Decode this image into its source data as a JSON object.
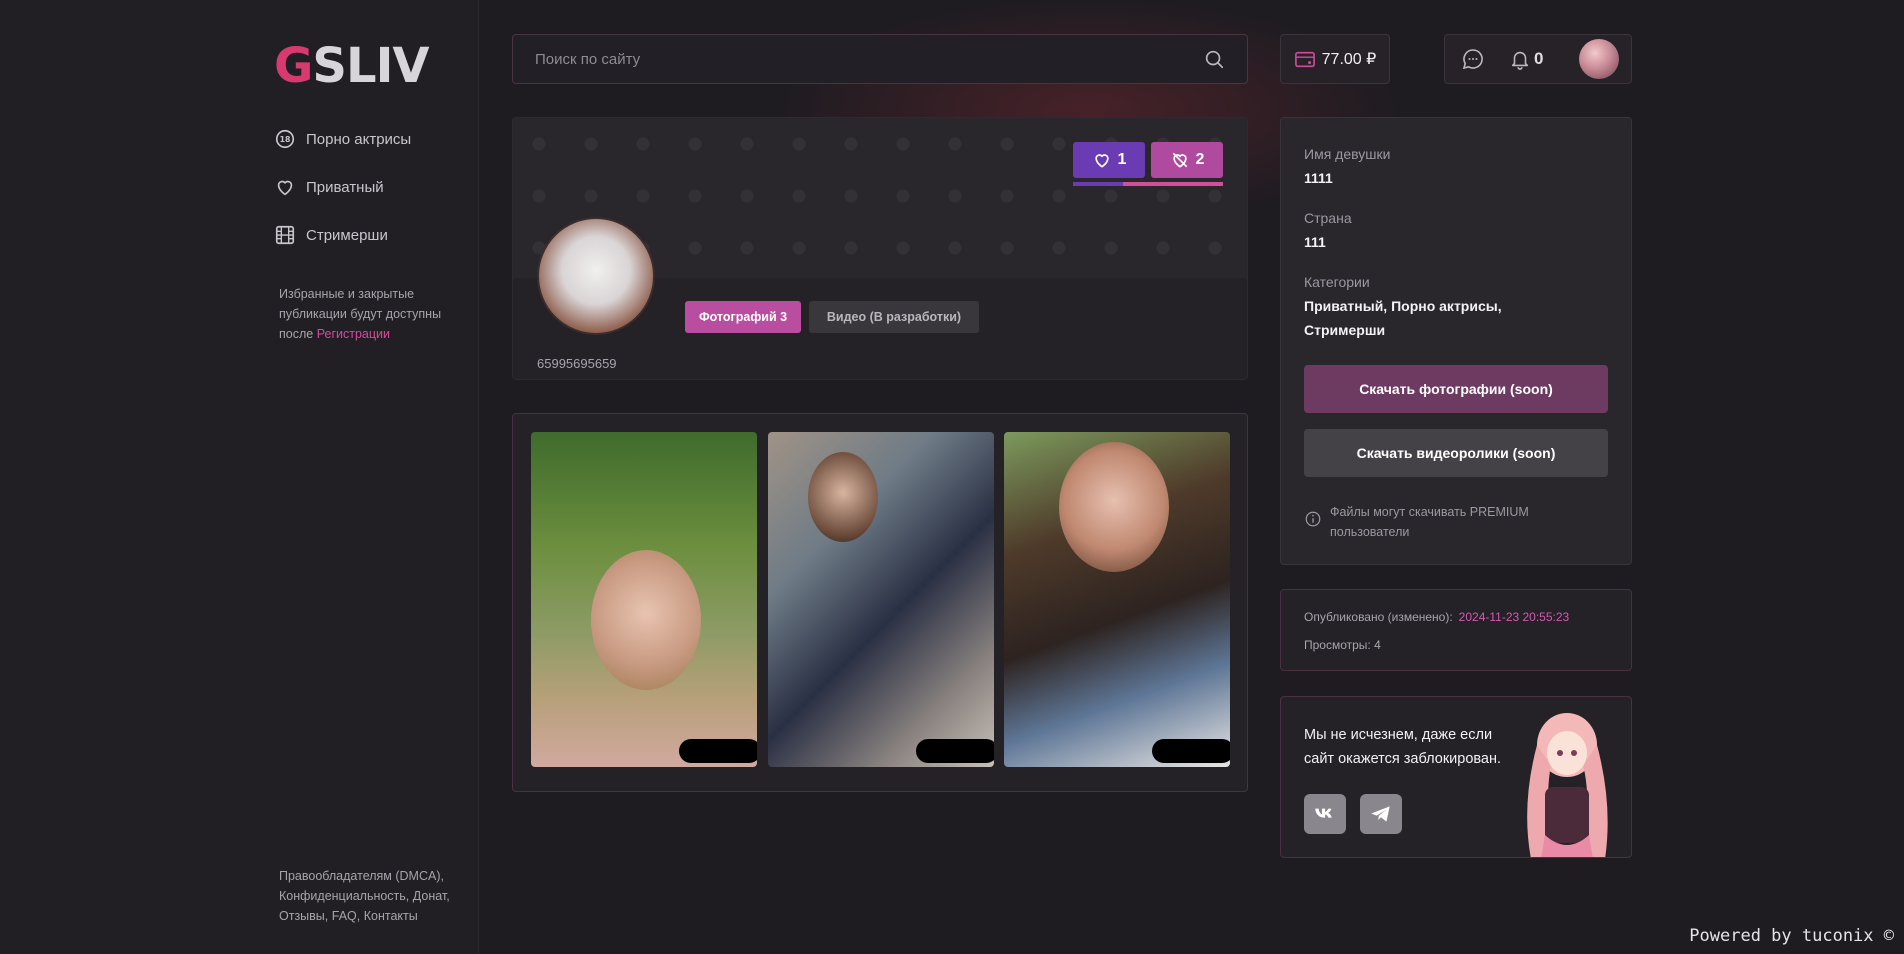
{
  "logo": {
    "first": "G",
    "rest": "SLIV"
  },
  "sidebar": {
    "items": [
      {
        "label": "Порно актрисы",
        "icon": "18-plus-icon"
      },
      {
        "label": "Приватный",
        "icon": "heart-icon"
      },
      {
        "label": "Стримерши",
        "icon": "film-icon"
      }
    ],
    "note_text": "Избранные и закрытые публикации будут доступны после ",
    "note_link": "Регистрации",
    "footer": [
      "Правообладателям (DMCA),",
      "Конфиденциальность,",
      "Донат,",
      "Отзывы,",
      "FAQ,",
      "Контакты"
    ]
  },
  "search": {
    "placeholder": "Поиск по сайту",
    "icon": "search-icon"
  },
  "header": {
    "balance": "77.00 ₽",
    "notifications": "0"
  },
  "profile": {
    "likes": "1",
    "dislikes": "2",
    "vote_like_share": 0.33,
    "tab_photos": "Фотографий 3",
    "tab_video": "Видео (В разработки)",
    "id_text": "65995695659"
  },
  "info": {
    "name_label": "Имя девушки",
    "name_value": "1111",
    "country_label": "Страна",
    "country_value": "111",
    "categories_label": "Категории",
    "categories_value": "Приватный, Порно актрисы, Стримерши",
    "download_photos": "Скачать фотографии (soon)",
    "download_videos": "Скачать видеоролики (soon)",
    "premium_note": "Файлы могут скачивать PREMIUM пользователи"
  },
  "meta": {
    "published_label": "Опубликовано (изменено):",
    "published_value": "2024-11-23 20:55:23",
    "views": "Просмотры: 4"
  },
  "promo": {
    "text": "Мы не исчезнем, даже если сайт окажется заблокирован."
  },
  "powered": "Powered by tuconix ©",
  "colors": {
    "accent": "#b94ea0",
    "logo_red": "#d63a6e",
    "like": "#6b3bb3",
    "date": "#d45ab0"
  }
}
